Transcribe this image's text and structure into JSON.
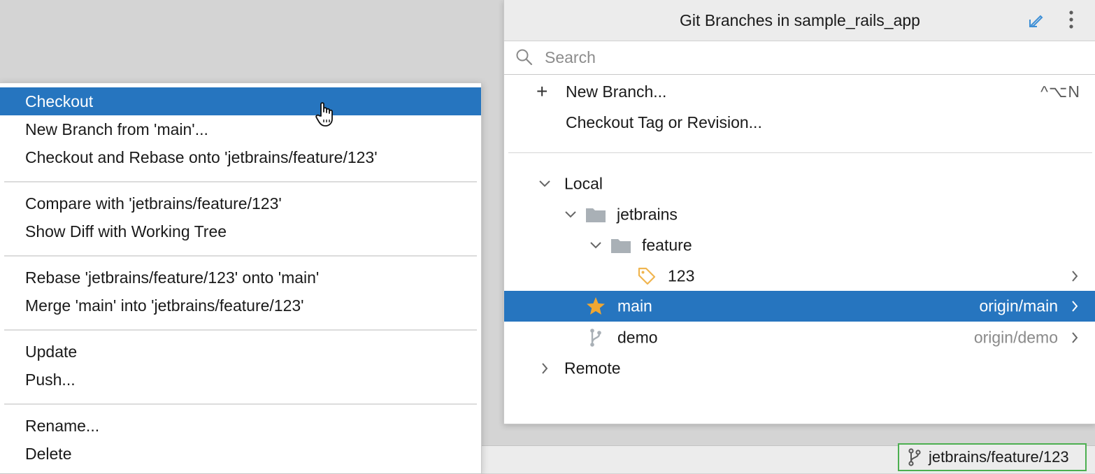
{
  "context_menu": {
    "groups": [
      [
        "Checkout",
        "New Branch from 'main'...",
        "Checkout and Rebase onto 'jetbrains/feature/123'"
      ],
      [
        "Compare with 'jetbrains/feature/123'",
        "Show Diff with Working Tree"
      ],
      [
        "Rebase 'jetbrains/feature/123' onto 'main'",
        "Merge 'main' into 'jetbrains/feature/123'"
      ],
      [
        "Update",
        "Push..."
      ],
      [
        "Rename...",
        "Delete"
      ]
    ],
    "active_item": "Checkout"
  },
  "branches_popup": {
    "title": "Git Branches in sample_rails_app",
    "search_placeholder": "Search",
    "actions": {
      "new_branch": {
        "label": "New Branch...",
        "shortcut": "^⌥N"
      },
      "checkout_tag": {
        "label": "Checkout Tag or Revision..."
      }
    },
    "tree": {
      "local_label": "Local",
      "folder_jetbrains": "jetbrains",
      "folder_feature": "feature",
      "branch_123": "123",
      "branch_main": {
        "name": "main",
        "tracking": "origin/main"
      },
      "branch_demo": {
        "name": "demo",
        "tracking": "origin/demo"
      },
      "remote_label": "Remote"
    }
  },
  "status_bar": {
    "current_branch": "jetbrains/feature/123"
  },
  "colors": {
    "selection": "#2675bf",
    "favorite_star": "#f0a732",
    "tag_icon": "#f0b54f",
    "folder_icon": "#a9b0b6",
    "highlight_border": "#4caf50",
    "edit_icon": "#3d8fd6"
  }
}
